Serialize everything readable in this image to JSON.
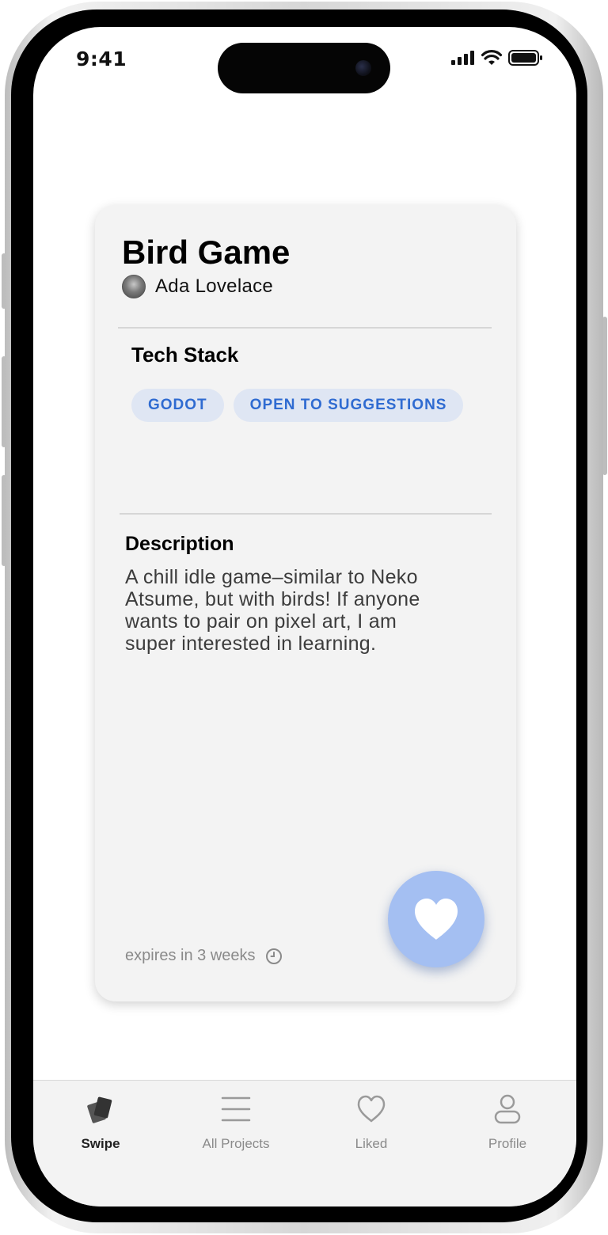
{
  "status_bar": {
    "time": "9:41",
    "icons": [
      "signal-icon",
      "wifi-icon",
      "battery-icon"
    ]
  },
  "card": {
    "title": "Bird Game",
    "author": "Ada Lovelace",
    "tech_stack": {
      "heading": "Tech Stack",
      "tags": [
        "GODOT",
        "OPEN TO SUGGESTIONS"
      ]
    },
    "description": {
      "heading": "Description",
      "lines": [
        "A chill idle game–similar to Neko",
        "Atsume, but with birds! If anyone",
        "wants to pair on pixel art, I am",
        "super interested in learning."
      ]
    },
    "expires": "expires in 3 weeks",
    "like_icon": "heart-icon"
  },
  "tabbar": {
    "tabs": [
      {
        "label": "Swipe",
        "icon": "cards-icon",
        "active": true
      },
      {
        "label": "All Projects",
        "icon": "list-icon",
        "active": false
      },
      {
        "label": "Liked",
        "icon": "heart-outline-icon",
        "active": false
      },
      {
        "label": "Profile",
        "icon": "person-icon",
        "active": false
      }
    ]
  },
  "colors": {
    "chip_bg": "#dfe6f3",
    "chip_text": "#2f6bd1",
    "like_button": "#a4bff2",
    "card_bg": "#f3f3f3"
  }
}
